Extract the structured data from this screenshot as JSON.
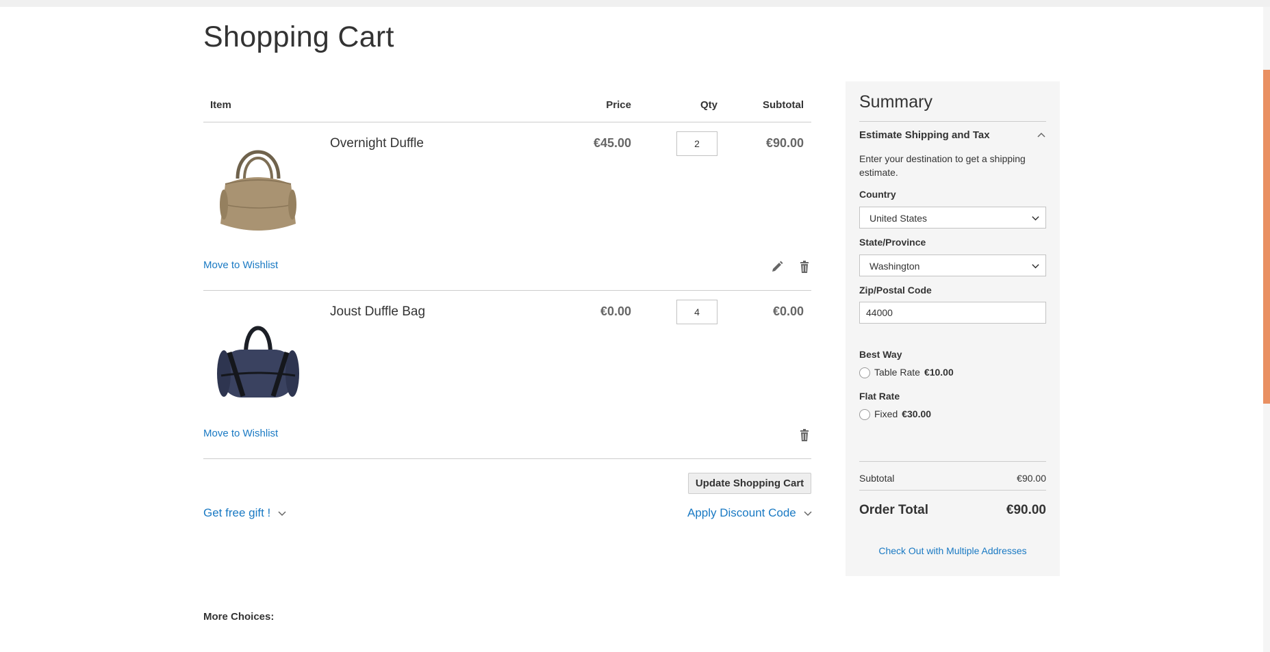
{
  "page": {
    "title": "Shopping Cart"
  },
  "cart": {
    "headers": {
      "item": "Item",
      "price": "Price",
      "qty": "Qty",
      "subtotal": "Subtotal"
    },
    "items": [
      {
        "name": "Overnight Duffle",
        "price": "€45.00",
        "qty": "2",
        "subtotal": "€90.00",
        "wishlist": "Move to Wishlist",
        "image": "tan-duffle-bag"
      },
      {
        "name": "Joust Duffle Bag",
        "price": "€0.00",
        "qty": "4",
        "subtotal": "€0.00",
        "wishlist": "Move to Wishlist",
        "image": "navy-duffle-bag"
      }
    ],
    "update_label": "Update Shopping Cart",
    "gift_label": "Get free gift !",
    "discount_label": "Apply Discount Code"
  },
  "more_choices": "More Choices:",
  "summary": {
    "title": "Summary",
    "estimate_title": "Estimate Shipping and Tax",
    "estimate_desc": "Enter your destination to get a shipping estimate.",
    "country_label": "Country",
    "country_value": "United States",
    "state_label": "State/Province",
    "state_value": "Washington",
    "zip_label": "Zip/Postal Code",
    "zip_value": "44000",
    "carriers": [
      {
        "title": "Best Way",
        "method": "Table Rate",
        "price": "€10.00"
      },
      {
        "title": "Flat Rate",
        "method": "Fixed",
        "price": "€30.00"
      }
    ],
    "subtotal_label": "Subtotal",
    "subtotal_value": "€90.00",
    "order_total_label": "Order Total",
    "order_total_value": "€90.00",
    "multi_address_label": "Check Out with Multiple Addresses"
  },
  "colors": {
    "link": "#1979c3",
    "accent": "#e99062",
    "summary_bg": "#f5f5f5"
  }
}
